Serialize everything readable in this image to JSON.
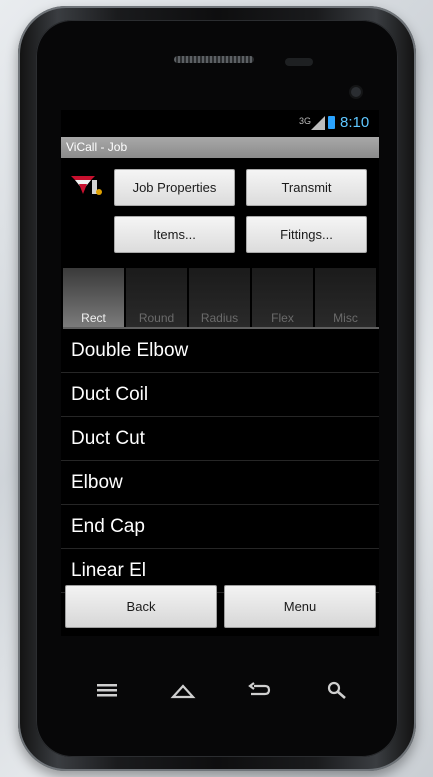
{
  "status": {
    "network": "3G",
    "time": "8:10"
  },
  "app": {
    "title": "ViCall - Job"
  },
  "buttons": {
    "job_properties": "Job Properties",
    "transmit": "Transmit",
    "items": "Items...",
    "fittings": "Fittings..."
  },
  "tabs": [
    {
      "label": "Rect",
      "active": true
    },
    {
      "label": "Round"
    },
    {
      "label": "Radius"
    },
    {
      "label": "Flex"
    },
    {
      "label": "Misc"
    }
  ],
  "list": [
    "Double Elbow",
    "Duct Coil",
    "Duct Cut",
    "Elbow",
    "End Cap",
    "Linear El"
  ],
  "bottom": {
    "back": "Back",
    "menu": "Menu"
  },
  "colors": {
    "accent": "#5fc7ff",
    "titlebar": "#9a9a9a",
    "logo_red": "#c8102e"
  }
}
